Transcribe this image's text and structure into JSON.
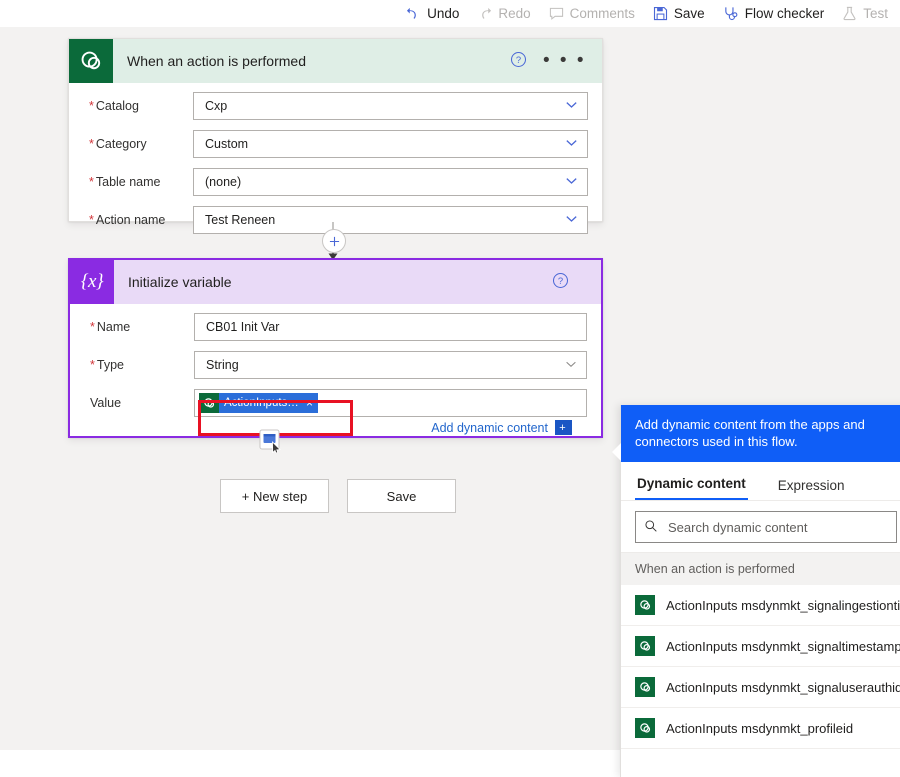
{
  "commandbar": {
    "items": [
      {
        "label": "Undo",
        "icon": "undo-icon",
        "disabled": false
      },
      {
        "label": "Redo",
        "icon": "redo-icon",
        "disabled": true
      },
      {
        "label": "Comments",
        "icon": "comments-icon",
        "disabled": true
      },
      {
        "label": "Save",
        "icon": "save-icon",
        "disabled": false
      },
      {
        "label": "Flow checker",
        "icon": "flow-checker-icon",
        "disabled": false
      },
      {
        "label": "Test",
        "icon": "test-flask-icon",
        "disabled": true
      }
    ]
  },
  "trigger_card": {
    "title": "When an action is performed",
    "icon": "dynamics365-icon",
    "header_color": "#dfeee6",
    "icon_color": "#0b6a3a",
    "help_label": "?",
    "more_label": "• • •",
    "fields": [
      {
        "label": "Catalog",
        "required": true,
        "value": "Cxp"
      },
      {
        "label": "Category",
        "required": true,
        "value": "Custom"
      },
      {
        "label": "Table name",
        "required": true,
        "value": "(none)"
      },
      {
        "label": "Action name",
        "required": true,
        "value": "Test Reneen"
      }
    ]
  },
  "connector": {
    "add_label": "+"
  },
  "initvar_card": {
    "title": "Initialize variable",
    "icon": "variable-braces-icon",
    "icon_glyph": "{x}",
    "header_color": "#e9daf7",
    "icon_color": "#8a2be2",
    "selected_border": "#8a2be2",
    "fields": [
      {
        "label": "Name",
        "required": true,
        "value": "CB01 Init Var"
      },
      {
        "label": "Type",
        "required": true,
        "value": "String"
      }
    ],
    "value_row": {
      "label": "Value",
      "required": false,
      "token": {
        "label": "ActionInputs m...",
        "icon": "dynamics365-icon",
        "remove_label": "×",
        "token_color": "#2b6ed9"
      }
    },
    "add_dynamic_content": {
      "label": "Add dynamic content",
      "badge": "+"
    }
  },
  "annotation": {
    "color": "#e81123"
  },
  "buttons": [
    {
      "label": "+ New step"
    },
    {
      "label": "Save"
    }
  ],
  "dynamic_panel": {
    "banner": "Add dynamic content from the apps and connectors used in this flow.",
    "banner_color": "#0f5ef7",
    "tabs": [
      {
        "label": "Dynamic content",
        "active": true
      },
      {
        "label": "Expression",
        "active": false
      }
    ],
    "search": {
      "placeholder": "Search dynamic content",
      "value": "",
      "icon": "search-icon"
    },
    "group_label": "When an action is performed",
    "items": [
      {
        "label": "ActionInputs msdynmkt_signalingestiontimestamp",
        "icon": "dynamics365-icon"
      },
      {
        "label": "ActionInputs msdynmkt_signaltimestamp",
        "icon": "dynamics365-icon"
      },
      {
        "label": "ActionInputs msdynmkt_signaluserauthid",
        "icon": "dynamics365-icon"
      },
      {
        "label": "ActionInputs msdynmkt_profileid",
        "icon": "dynamics365-icon"
      }
    ]
  }
}
